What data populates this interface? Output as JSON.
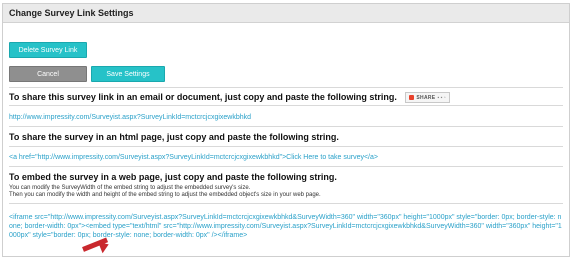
{
  "title": "Change Survey Link Settings",
  "buttons": {
    "delete": "Delete Survey Link",
    "cancel": "Cancel",
    "save": "Save Settings"
  },
  "sections": {
    "share_heading": "To share this survey link in an email or document, just copy and paste the following string.",
    "share_widget": {
      "label": "SHARE",
      "bits": "▪ ▪ ▫"
    },
    "survey_url": "http://www.impressity.com/Surveyist.aspx?SurveyLinkId=mctcrcjcxgixewkbhkd",
    "html_heading": "To share the survey in an html page, just copy and paste the following string.",
    "html_string": "<a href=\"http://www.impressity.com/Surveyist.aspx?SurveyLinkId=mctcrcjcxgixewkbhkd\">Click Here to take survey</a>",
    "embed_heading": "To embed the survey in a web page, just copy and paste the following string.",
    "embed_note_1": "You can modify the SurveyWidth of the embed string to adjust the embedded survey's size.",
    "embed_note_2": "Then you can modify the width and height of the embed string to adjust the embedded object's size in your web page.",
    "embed_code": "<iframe src=\"http://www.impressity.com/Surveyist.aspx?SurveyLinkId=mctcrcjcxgixewkbhkd&SurveyWidth=360\" width=\"360px\" height=\"1000px\" style=\"border: 0px; border-style: none; border-width: 0px\"><embed type=\"text/html\" src=\"http://www.impressity.com/Surveyist.aspx?SurveyLinkId=mctcrcjcxgixewkbhkd&SurveyWidth=360\" width=\"360px\" height=\"1000px\" style=\"border: 0px; border-style: none; border-width: 0px\" /></iframe>"
  },
  "colors": {
    "accent": "#26c2c8",
    "link": "#2aa1c9",
    "arrow": "#c9282d"
  }
}
